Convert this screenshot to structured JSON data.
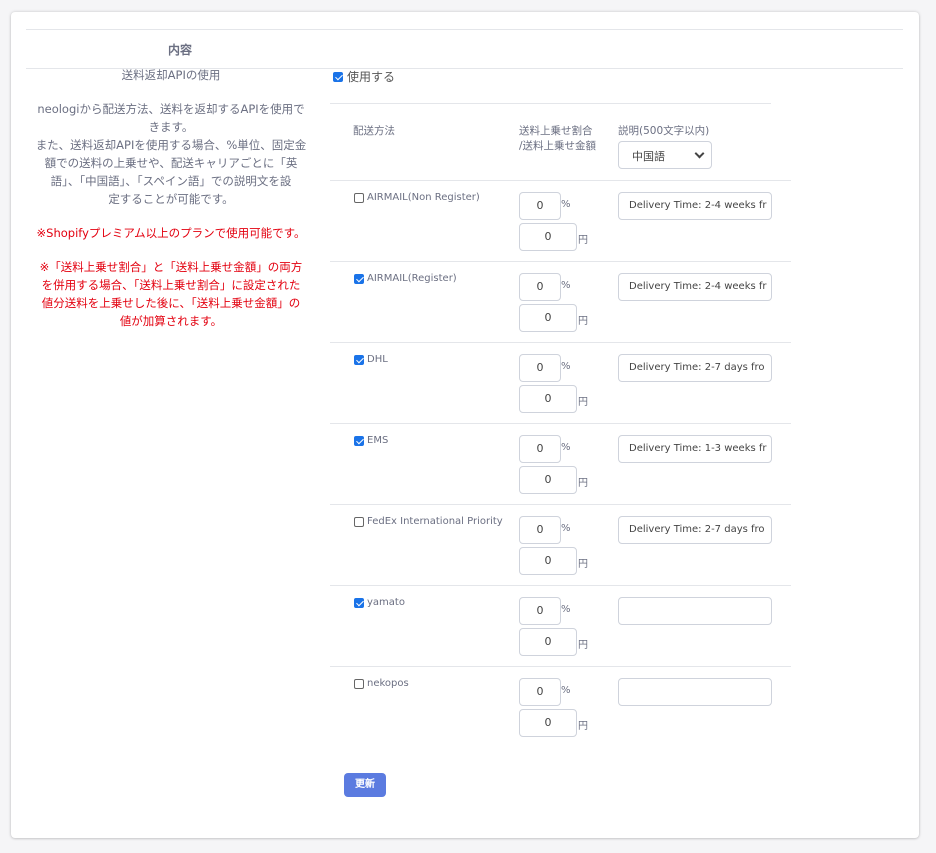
{
  "header": {
    "title": "内容"
  },
  "left": {
    "title": "送料返却APIの使用",
    "desc_lines": [
      "neologiから配送方法、送料を返却するAPIを使用で",
      "きます。",
      "また、送料返却APIを使用する場合、%単位、固定金",
      "額での送料の上乗せや、配送キャリアごとに「英",
      "語」、「中国語」、「スペイン語」での説明文を設",
      "定することが可能です。"
    ],
    "note1": "※Shopifyプレミアム以上のプランで使用可能です。",
    "note2_lines": [
      "※「送料上乗せ割合」と「送料上乗せ金額」の両方",
      "を併用する場合、「送料上乗せ割合」に設定された",
      "値分送料を上乗せした後に、「送料上乗せ金額」の",
      "値が加算されます。"
    ]
  },
  "use_api": {
    "label": "使用する",
    "checked": true
  },
  "table": {
    "col_method": "配送方法",
    "col_rate_line1": "送料上乗せ割合",
    "col_rate_line2": "/送料上乗せ金額",
    "col_desc": "説明(500文字以内)",
    "lang_select": "中国語",
    "pct_unit": "%",
    "yen_unit": "円",
    "rows": [
      {
        "name": "AIRMAIL(Non Register)",
        "checked": false,
        "pct": "0",
        "yen": "0",
        "desc": "Delivery Time: 2-4 weeks fr"
      },
      {
        "name": "AIRMAIL(Register)",
        "checked": true,
        "pct": "0",
        "yen": "0",
        "desc": "Delivery Time: 2-4 weeks fr"
      },
      {
        "name": "DHL",
        "checked": true,
        "pct": "0",
        "yen": "0",
        "desc": "Delivery Time: 2-7 days fro"
      },
      {
        "name": "EMS",
        "checked": true,
        "pct": "0",
        "yen": "0",
        "desc": "Delivery Time: 1-3 weeks fr"
      },
      {
        "name": "FedEx International Priority",
        "checked": false,
        "pct": "0",
        "yen": "0",
        "desc": "Delivery Time: 2-7 days fro"
      },
      {
        "name": "yamato",
        "checked": true,
        "pct": "0",
        "yen": "0",
        "desc": ""
      },
      {
        "name": "nekopos",
        "checked": false,
        "pct": "0",
        "yen": "0",
        "desc": ""
      }
    ]
  },
  "update_button": "更新"
}
